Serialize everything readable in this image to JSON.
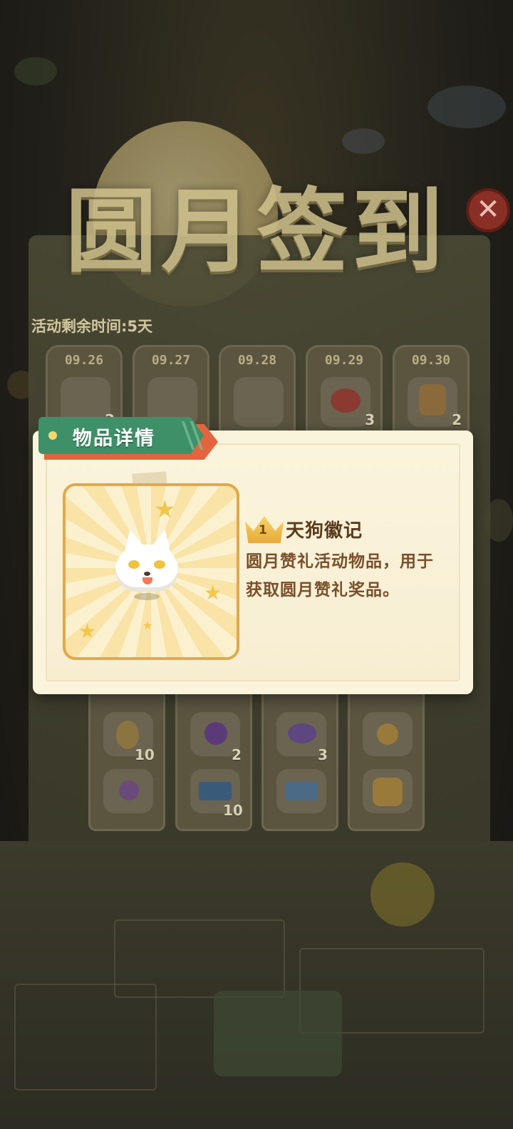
{
  "event": {
    "title": "圆月签到",
    "remaining_time": "活动剩余时间:5天",
    "close_icon": "close-icon",
    "days_row1": [
      {
        "date": "09.26",
        "count": "2",
        "icon": "ticket-icon"
      },
      {
        "date": "09.27",
        "count": "",
        "icon": "ticket-icon"
      },
      {
        "date": "09.28",
        "count": "",
        "icon": "ticket-icon"
      },
      {
        "date": "09.29",
        "count": "3",
        "icon": "red-fish-icon"
      },
      {
        "date": "09.30",
        "count": "2",
        "icon": "robot-icon"
      }
    ],
    "days_row2": [
      {
        "count_top": "10",
        "count_bottom": "",
        "icons": [
          "broom-icon",
          "purple-ornament-icon"
        ]
      },
      {
        "count_top": "2",
        "count_bottom": "10",
        "icons": [
          "purple-gem-icon",
          "blue-ticket-icon"
        ]
      },
      {
        "count_top": "3",
        "count_bottom": "",
        "icons": [
          "purple-bow-icon",
          "plane-ticket-icon"
        ]
      },
      {
        "count_top": "",
        "count_bottom": "",
        "icons": [
          "gold-charm-icon",
          "gold-bag-icon"
        ]
      }
    ]
  },
  "popup": {
    "header": "物品详情",
    "item": {
      "level": "1",
      "name": "天狗徽记",
      "description": "圆月赞礼活动物品，用于获取圆月赞礼奖品。",
      "icon": "white-fox-icon"
    }
  },
  "colors": {
    "ribbon_green": "#3e9069",
    "ribbon_red": "#e4643d",
    "popup_bg": "#fbf4dc",
    "frame_border": "#e1a94a",
    "text_brown": "#7a4f2a"
  }
}
